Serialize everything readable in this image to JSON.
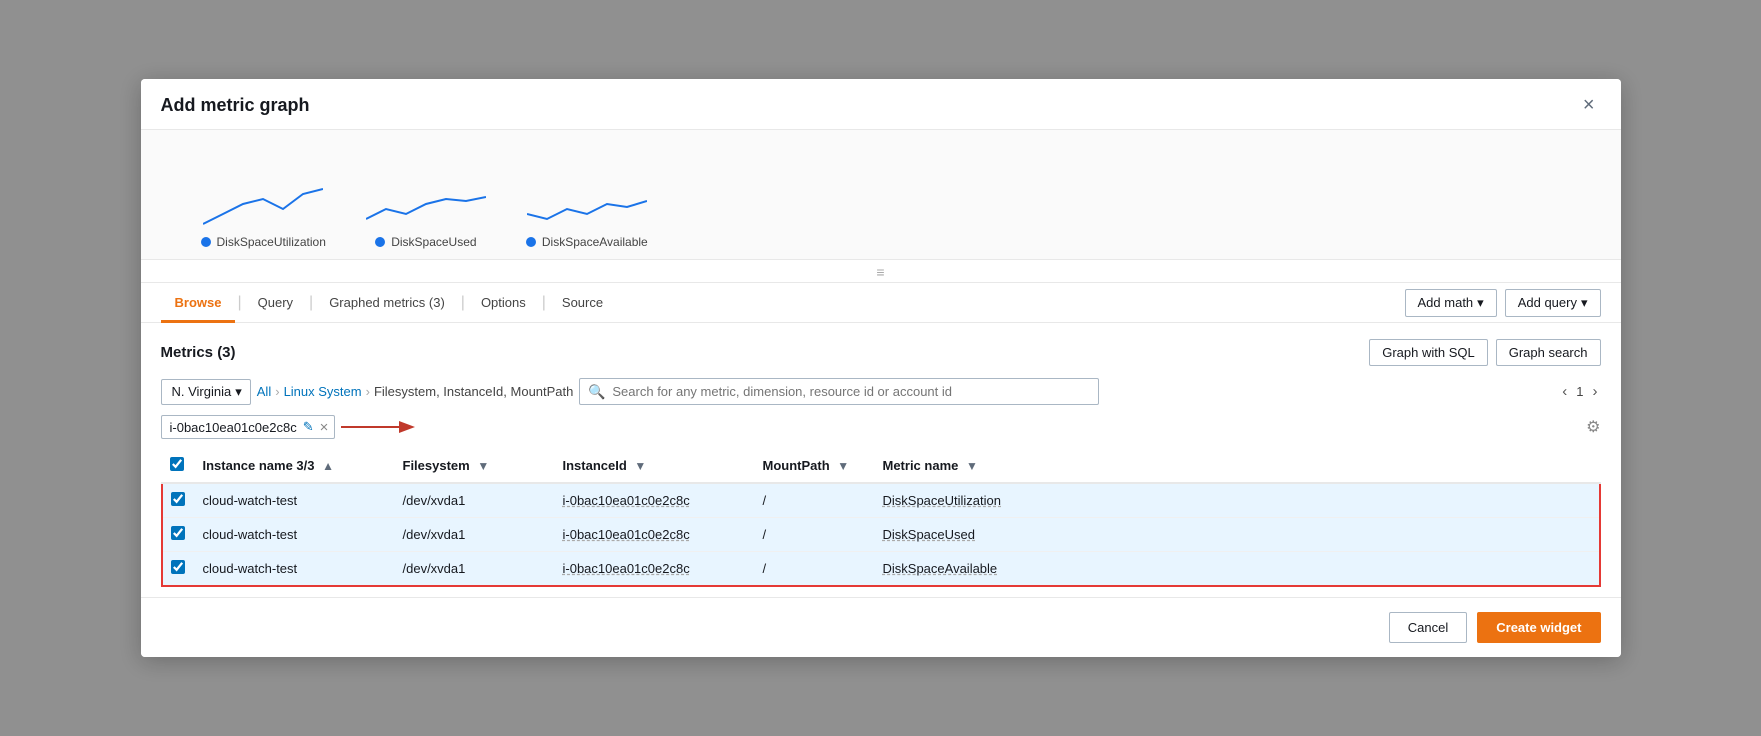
{
  "modal": {
    "title": "Add metric graph",
    "close_label": "×"
  },
  "graph_preview": {
    "legends": [
      {
        "label": "DiskSpaceUtilization",
        "color": "#1a73e8"
      },
      {
        "label": "DiskSpaceUsed",
        "color": "#1a73e8"
      },
      {
        "label": "DiskSpaceAvailable",
        "color": "#1a73e8"
      }
    ]
  },
  "tabs": [
    {
      "id": "browse",
      "label": "Browse",
      "active": true
    },
    {
      "id": "query",
      "label": "Query",
      "active": false
    },
    {
      "id": "graphed_metrics",
      "label": "Graphed metrics (3)",
      "active": false
    },
    {
      "id": "options",
      "label": "Options",
      "active": false
    },
    {
      "id": "source",
      "label": "Source",
      "active": false
    }
  ],
  "toolbar": {
    "add_math_label": "Add math",
    "add_query_label": "Add query"
  },
  "metrics_section": {
    "title": "Metrics (3)",
    "graph_with_sql_label": "Graph with SQL",
    "graph_search_label": "Graph search"
  },
  "filter_bar": {
    "region_label": "N. Virginia",
    "breadcrumb_all": "All",
    "breadcrumb_namespace": "Linux System",
    "breadcrumb_dimensions": "Filesystem, InstanceId, MountPath",
    "search_placeholder": "Search for any metric, dimension, resource id or account id",
    "page_current": "1"
  },
  "filter_tag": {
    "value": "i-0bac10ea01c0e2c8c"
  },
  "table": {
    "headers": [
      {
        "id": "instance_name",
        "label": "Instance name 3/3"
      },
      {
        "id": "filesystem",
        "label": "Filesystem"
      },
      {
        "id": "instance_id",
        "label": "InstanceId"
      },
      {
        "id": "mount_path",
        "label": "MountPath"
      },
      {
        "id": "metric_name",
        "label": "Metric name"
      }
    ],
    "rows": [
      {
        "checked": true,
        "instance_name": "cloud-watch-test",
        "filesystem": "/dev/xvda1",
        "instance_id": "i-0bac10ea01c0e2c8c",
        "mount_path": "/",
        "metric_name": "DiskSpaceUtilization",
        "selected": true
      },
      {
        "checked": true,
        "instance_name": "cloud-watch-test",
        "filesystem": "/dev/xvda1",
        "instance_id": "i-0bac10ea01c0e2c8c",
        "mount_path": "/",
        "metric_name": "DiskSpaceUsed",
        "selected": true
      },
      {
        "checked": true,
        "instance_name": "cloud-watch-test",
        "filesystem": "/dev/xvda1",
        "instance_id": "i-0bac10ea01c0e2c8c",
        "mount_path": "/",
        "metric_name": "DiskSpaceAvailable",
        "selected": true
      }
    ]
  },
  "footer": {
    "cancel_label": "Cancel",
    "create_label": "Create widget"
  }
}
